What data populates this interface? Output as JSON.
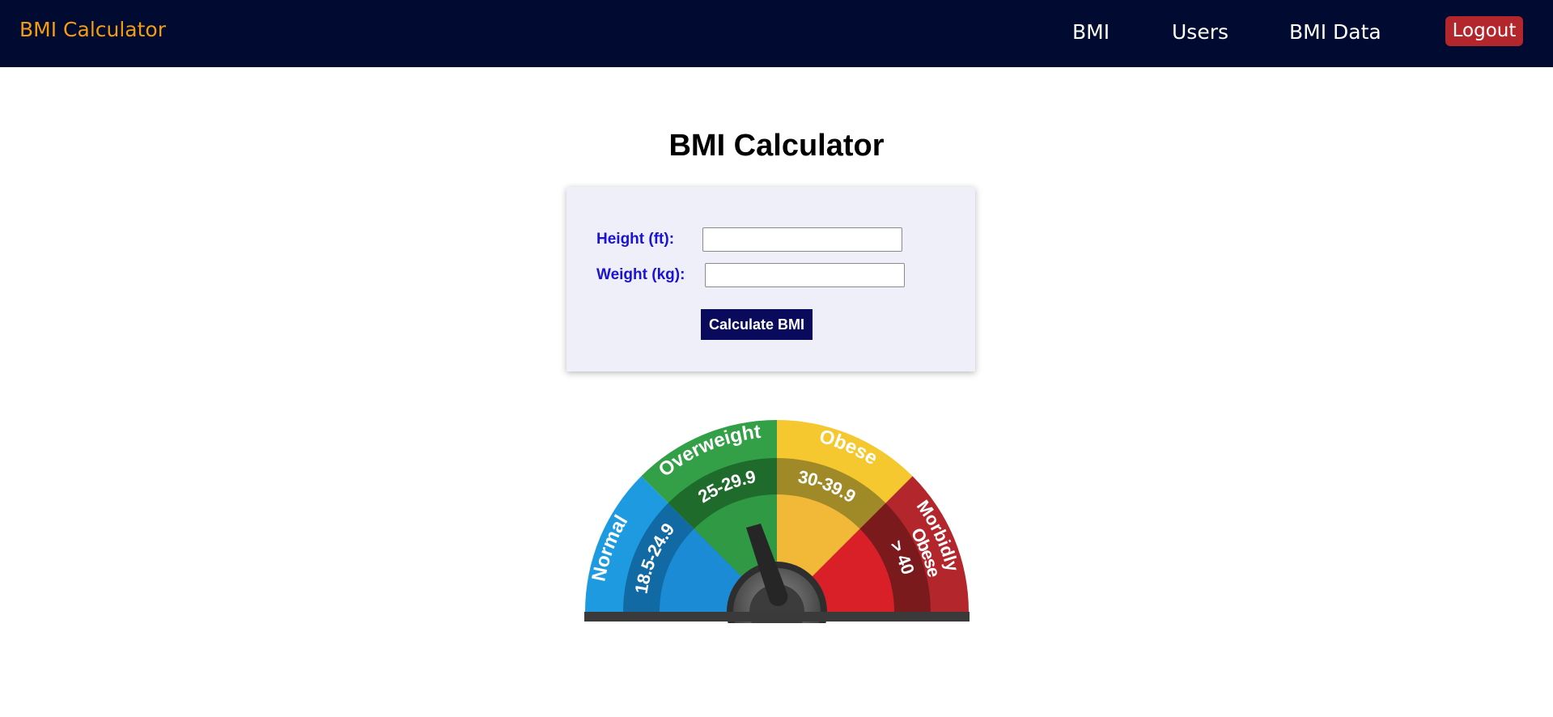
{
  "navbar": {
    "brand": "BMI Calculator",
    "links": [
      "BMI",
      "Users",
      "BMI Data"
    ],
    "logout_label": "Logout"
  },
  "page": {
    "title": "BMI Calculator"
  },
  "form": {
    "height_label": "Height (ft):",
    "height_value": "",
    "weight_label": "Weight (kg):",
    "weight_value": "",
    "submit_label": "Calculate BMI"
  },
  "gauge": {
    "segments": [
      {
        "name": "Normal",
        "range": "18.5-24.9",
        "color": "#1e9be0"
      },
      {
        "name": "Overweight",
        "range": "25-29.9",
        "color": "#33a047"
      },
      {
        "name": "Obese",
        "range": "30-39.9",
        "color": "#f5c82f"
      },
      {
        "name": "Morbidly Obese",
        "name_line1": "Morbidly",
        "name_line2": "Obese",
        "range": "> 40",
        "color": "#c1272d"
      }
    ]
  },
  "colors": {
    "navbar_bg": "#010b31",
    "brand": "#f39c12",
    "logout_bg": "#b3262c",
    "label": "#1a12d6",
    "button_bg": "#0a0a5c",
    "card_bg": "#efeff9"
  }
}
